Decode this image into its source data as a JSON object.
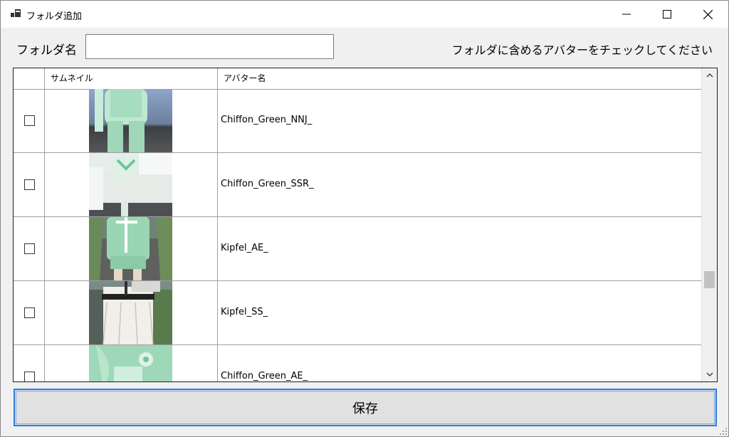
{
  "window": {
    "title": "フォルダ追加"
  },
  "form": {
    "folder_label": "フォルダ名",
    "folder_value": "",
    "hint": "フォルダに含めるアバターをチェックしてください"
  },
  "grid": {
    "columns": [
      "",
      "サムネイル",
      "アバター名"
    ],
    "rows": [
      {
        "checked": false,
        "thumbnail": "avatar-thumbnail",
        "name": "Chiffon_Green_NNJ_"
      },
      {
        "checked": false,
        "thumbnail": "avatar-thumbnail",
        "name": "Chiffon_Green_SSR_"
      },
      {
        "checked": false,
        "thumbnail": "avatar-thumbnail",
        "name": "Kipfel_AE_"
      },
      {
        "checked": false,
        "thumbnail": "avatar-thumbnail",
        "name": "Kipfel_SS_"
      },
      {
        "checked": false,
        "thumbnail": "avatar-thumbnail",
        "name": "Chiffon_Green_AE_"
      }
    ]
  },
  "actions": {
    "save_label": "保存"
  },
  "icons": {
    "app": "folder-app-icon",
    "minimize": "minimize-icon",
    "maximize": "maximize-icon",
    "close": "close-icon",
    "scroll_up": "chevron-up-icon",
    "scroll_down": "chevron-down-icon"
  },
  "colors": {
    "accent": "#2f7bd6"
  }
}
